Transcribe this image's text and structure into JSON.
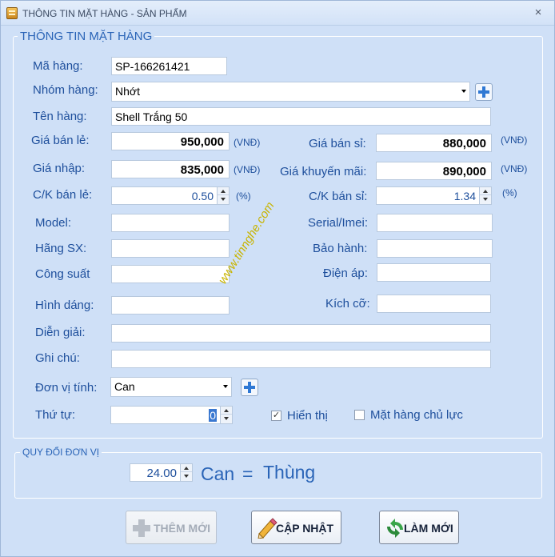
{
  "window": {
    "title": "THÔNG TIN MẶT HÀNG - SẢN PHẨM",
    "close_glyph": "×"
  },
  "product_group": {
    "title": "THÔNG TIN MẶT HÀNG",
    "ma_hang": {
      "label": "Mã hàng:",
      "value": "SP-166261421"
    },
    "nhom_hang": {
      "label": "Nhóm hàng:",
      "value": "Nhớt"
    },
    "ten_hang": {
      "label": "Tên hàng:",
      "value": "Shell Trắng 50"
    },
    "gia_ban_le": {
      "label": "Giá bán lẻ:",
      "value": "950,000",
      "unit": "(VNĐ)"
    },
    "gia_ban_si": {
      "label": "Giá bán sỉ:",
      "value": "880,000",
      "unit": "(VNĐ)"
    },
    "gia_nhap": {
      "label": "Giá nhập:",
      "value": "835,000",
      "unit": "(VNĐ)"
    },
    "gia_khuyen_mai": {
      "label": "Giá khuyến mãi:",
      "value": "890,000",
      "unit": "(VNĐ)"
    },
    "ck_ban_le": {
      "label": "C/K bán lẻ:",
      "value": "0.50",
      "unit": "(%)"
    },
    "ck_ban_si": {
      "label": "C/K bán sỉ:",
      "value": "1.34",
      "unit": "(%)"
    },
    "model": {
      "label": "Model:",
      "value": ""
    },
    "serial": {
      "label": "Serial/Imei:",
      "value": ""
    },
    "hang_sx": {
      "label": "Hãng SX:",
      "value": ""
    },
    "bao_hanh": {
      "label": "Bảo hành:",
      "value": ""
    },
    "cong_suat": {
      "label": "Công suất",
      "value": ""
    },
    "dien_ap": {
      "label": "Điện áp:",
      "value": ""
    },
    "hinh_dang": {
      "label": "Hình dáng:",
      "value": ""
    },
    "kich_co": {
      "label": "Kích cỡ:",
      "value": ""
    },
    "dien_giai": {
      "label": "Diễn giải:",
      "value": ""
    },
    "ghi_chu": {
      "label": "Ghi chú:",
      "value": ""
    },
    "don_vi_tinh": {
      "label": "Đơn vị tính:",
      "value": "Can"
    },
    "thu_tu": {
      "label": "Thứ tự:",
      "value": "0"
    },
    "hien_thi": {
      "label": "Hiển thị",
      "checked": true,
      "mark": "✓"
    },
    "mat_hang_chu_luc": {
      "label": "Mặt hàng chủ lực",
      "checked": false
    }
  },
  "watermark": "www.tinnghe.com",
  "conversion_group": {
    "title": "QUY ĐỔI ĐƠN VỊ",
    "factor": "24.00",
    "from_unit": "Can",
    "equals": "=",
    "to_unit": "Thùng"
  },
  "buttons": {
    "them_moi": {
      "label": "THÊM MỚI",
      "enabled": false
    },
    "cap_nhat": {
      "label": "CẬP NHẬT",
      "enabled": true
    },
    "lam_moi": {
      "label": "LÀM MỚI",
      "enabled": true
    }
  },
  "colors": {
    "window_bg": "#cfe0f7",
    "label_text": "#1e4f9c",
    "group_title": "#2a64b7",
    "plus_icon": "#2f78d4"
  }
}
